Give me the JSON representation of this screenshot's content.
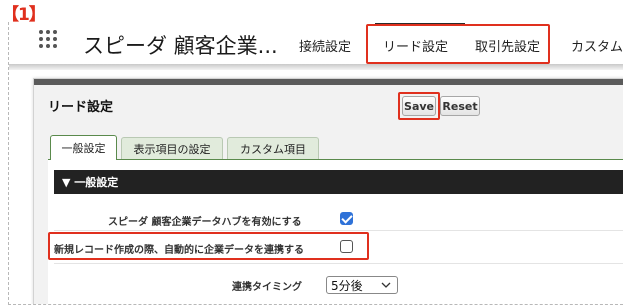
{
  "annotation": {
    "step_label": "【1】",
    "accent_color": "#e0301e"
  },
  "app": {
    "name": "スピーダ 顧客企業...",
    "nav_tabs": [
      {
        "label": "接続設定",
        "active": false
      },
      {
        "label": "リード設定",
        "active": true
      },
      {
        "label": "取引先設定",
        "active": false
      },
      {
        "label": "カスタム",
        "active": false
      }
    ]
  },
  "page": {
    "title": "リード設定",
    "save_label": "Save",
    "reset_label": "Reset",
    "tabs": [
      {
        "label": "一般設定",
        "active": true
      },
      {
        "label": "表示項目の設定",
        "active": false
      },
      {
        "label": "カスタム項目",
        "active": false
      }
    ],
    "section_title": "▼ 一般設定",
    "settings": [
      {
        "label": "スピーダ 顧客企業データハブを有効にする",
        "checked": true
      },
      {
        "label": "新規レコード作成の際、自動的に企業データを連携する",
        "checked": false
      }
    ],
    "timing": {
      "label": "連携タイミング",
      "value": "5分後"
    }
  }
}
